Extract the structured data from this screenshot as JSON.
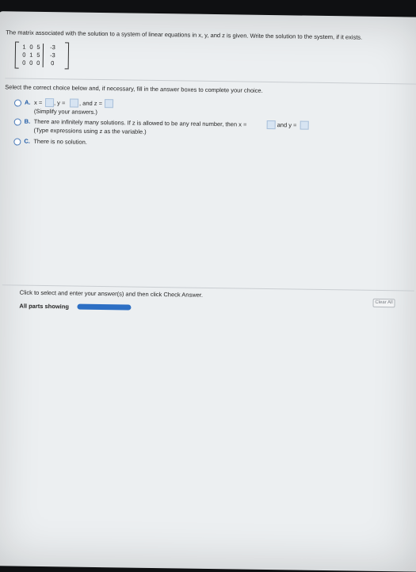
{
  "question": {
    "prompt": "The matrix associated with the solution to a system of linear equations in x, y, and z is given. Write the solution to the system, if it exists.",
    "matrix": [
      [
        "1",
        "0",
        "5",
        "-3"
      ],
      [
        "0",
        "1",
        "5",
        "-3"
      ],
      [
        "0",
        "0",
        "0",
        "0"
      ]
    ],
    "instruction": "Select the correct choice below and, if necessary, fill in the answer boxes to complete your choice."
  },
  "choices": {
    "a": {
      "letter": "A.",
      "x_label": "x =",
      "y_label": ", y =",
      "z_label": ", and z =",
      "note": "(Simplify your answers.)"
    },
    "b": {
      "letter": "B.",
      "text": "There are infinitely many solutions. If z is allowed to be any real number, then x =",
      "and_y": "and y =",
      "note": "(Type expressions using z as the variable.)"
    },
    "c": {
      "letter": "C.",
      "text": "There is no solution."
    }
  },
  "footer": {
    "hint": "Click to select and enter your answer(s) and then click Check Answer.",
    "parts": "All parts showing",
    "clear": "Clear All"
  },
  "colors": {
    "accent": "#1a57a3",
    "progress": "#2d6fc4",
    "answer_box": "#d7e4f2"
  }
}
